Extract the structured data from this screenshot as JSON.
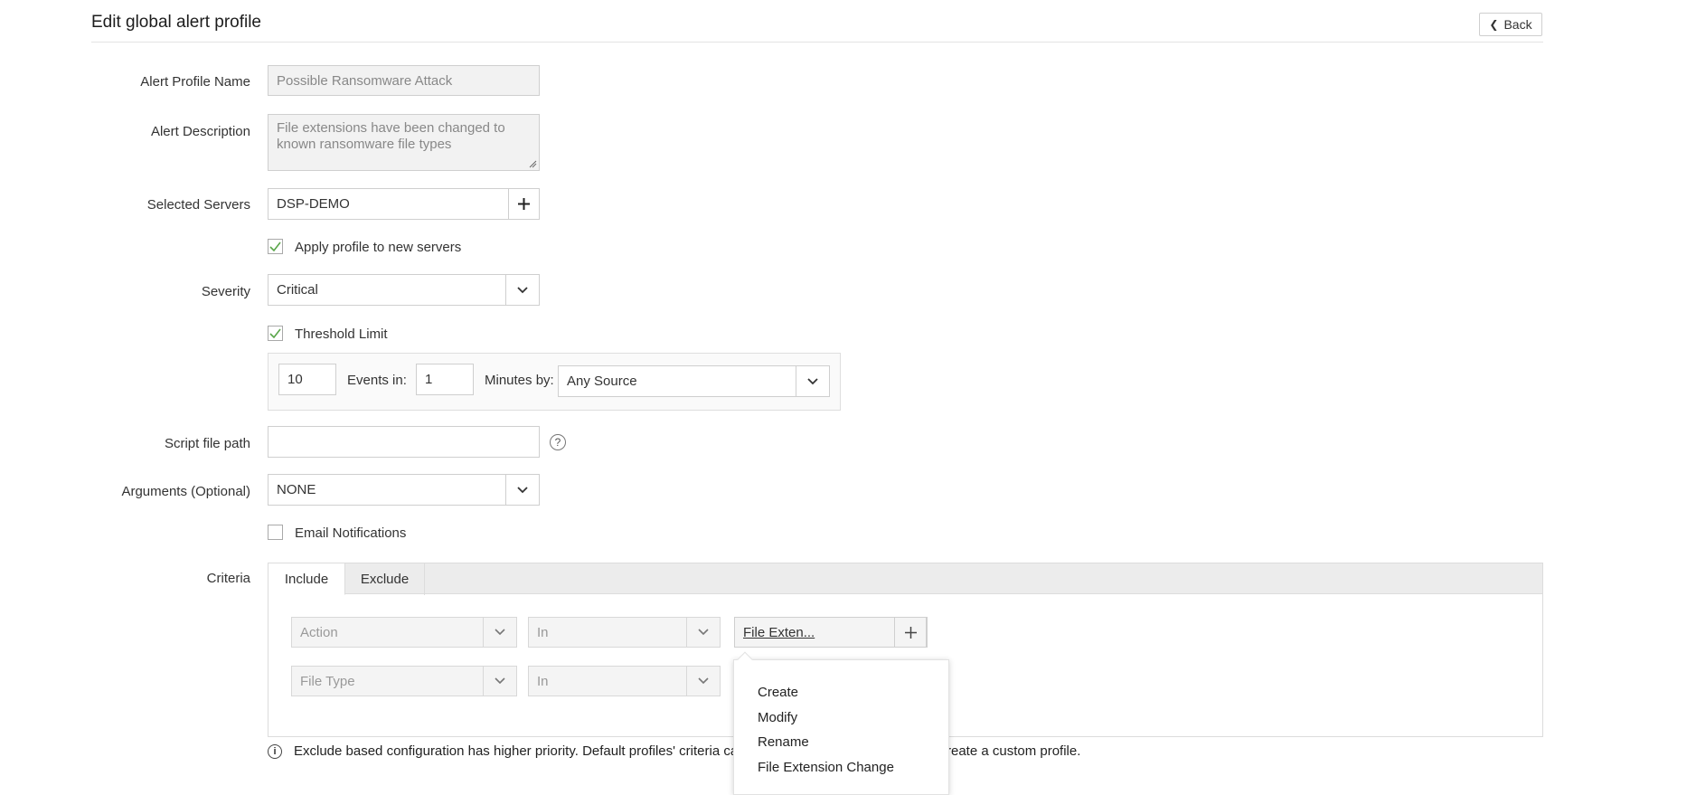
{
  "header": {
    "title": "Edit global alert profile",
    "back_label": "Back"
  },
  "form": {
    "profile_name": {
      "label": "Alert Profile Name",
      "value": "Possible Ransomware Attack"
    },
    "description": {
      "label": "Alert Description",
      "value": "File extensions have been changed to known ransomware file types"
    },
    "servers": {
      "label": "Selected Servers",
      "value": "DSP-DEMO"
    },
    "apply_new": {
      "label": "Apply profile to new servers",
      "checked": true
    },
    "severity": {
      "label": "Severity",
      "value": "Critical"
    },
    "threshold": {
      "label": "Threshold Limit",
      "checked": true,
      "events_value": "10",
      "events_label": "Events in:",
      "minutes_value": "1",
      "minutes_label": "Minutes by:",
      "source_value": "Any Source"
    },
    "script": {
      "label": "Script file path",
      "value": ""
    },
    "arguments": {
      "label": "Arguments (Optional)",
      "value": "NONE"
    },
    "email": {
      "label": "Email Notifications",
      "checked": false
    },
    "criteria": {
      "label": "Criteria",
      "tabs": [
        "Include",
        "Exclude"
      ],
      "active_tab": "Include",
      "rows": [
        {
          "field": "Action",
          "operator": "In",
          "value": "File Exten..."
        },
        {
          "field": "File Type",
          "operator": "In"
        }
      ],
      "popup_items": [
        "Create",
        "Modify",
        "Rename",
        "File Extension Change"
      ]
    }
  },
  "info": {
    "text_left": "Exclude based configuration has higher priority. Default profiles' criteria ca",
    "text_right": "reate a custom profile."
  }
}
